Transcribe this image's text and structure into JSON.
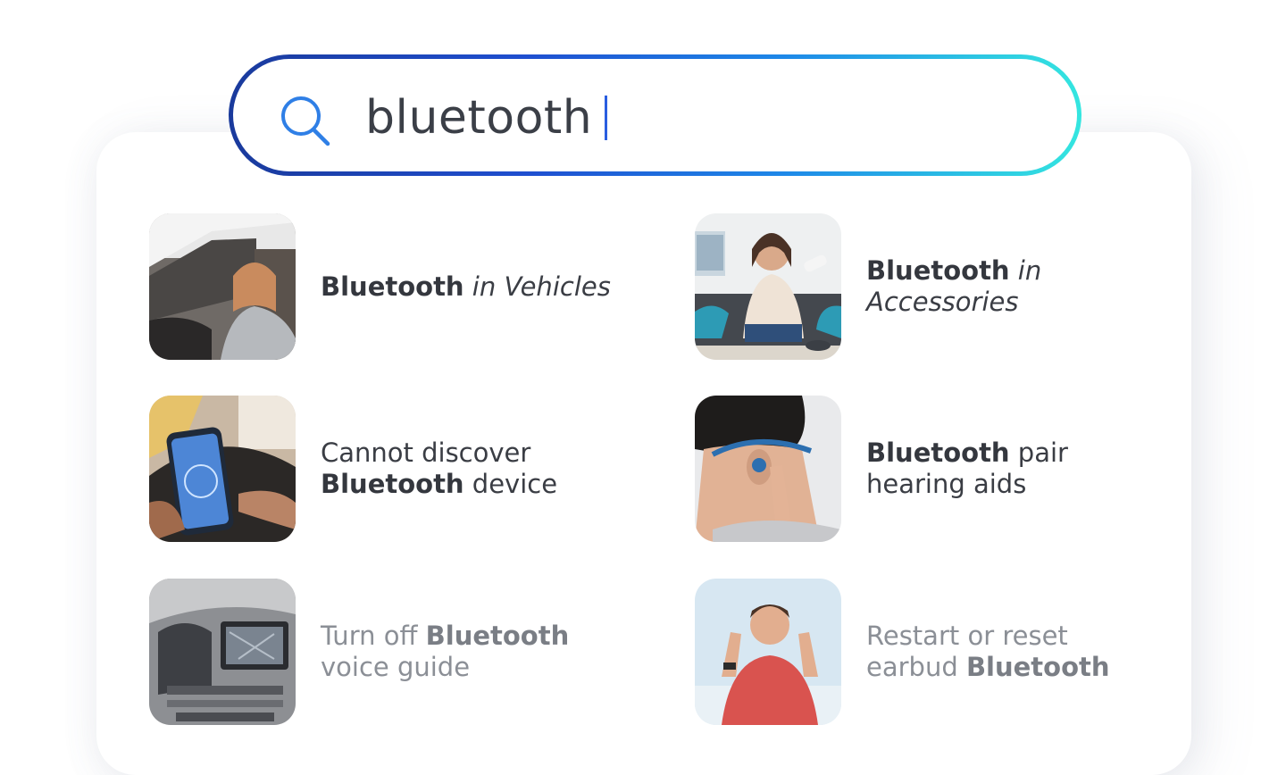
{
  "search": {
    "query": "bluetooth",
    "icon": "search-icon"
  },
  "colors": {
    "gradient_start": "#1a3a9c",
    "gradient_mid": "#1e88e8",
    "gradient_end": "#34e6e0",
    "text": "#3a3d44",
    "muted_text": "#8b8f96"
  },
  "results": {
    "left": [
      {
        "bold": "Bluetooth",
        "italic": " in Vehicles"
      },
      {
        "line1": "Cannot discover",
        "bold": "Bluetooth",
        "rest": " device"
      },
      {
        "line1": "Turn off ",
        "bold": "Bluetooth",
        "rest": "voice guide"
      }
    ],
    "right": [
      {
        "bold": "Bluetooth",
        "italic": " in",
        "italic2": "Accessories"
      },
      {
        "bold": "Bluetooth",
        "rest": " pair",
        "line2": "hearing aids"
      },
      {
        "line1": "Restart or reset",
        "rest": " earbud ",
        "bold": "Bluetooth"
      }
    ]
  }
}
